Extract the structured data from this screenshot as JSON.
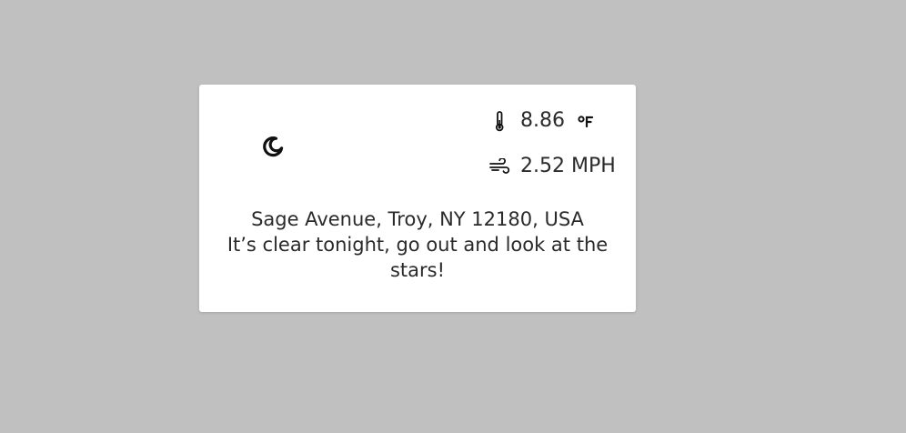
{
  "weather": {
    "condition_icon": "moon-icon",
    "temperature": {
      "icon": "thermometer-icon",
      "value": "8.86",
      "unit_icon": "fahrenheit-icon"
    },
    "wind": {
      "icon": "wind-icon",
      "value": "2.52 MPH"
    },
    "location": "Sage Avenue, Troy, NY 12180, USA",
    "message": "It’s clear tonight, go out and look at the stars!"
  },
  "colors": {
    "background": "#c0c0c0",
    "card": "#ffffff",
    "text": "#2a2a2a"
  }
}
